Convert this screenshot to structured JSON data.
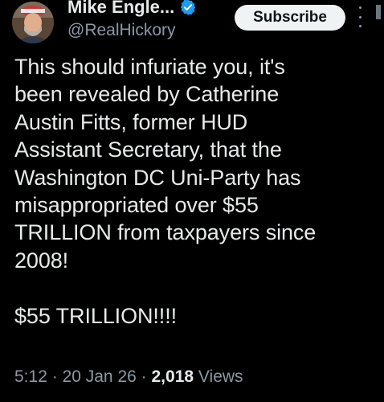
{
  "author": {
    "display_name": "Mike Engle...",
    "handle": "@RealHickory",
    "verified_icon": "verified-badge-icon",
    "avatar": "profile-photo"
  },
  "actions": {
    "subscribe_label": "Subscribe",
    "more_icon": "more-options-icon"
  },
  "tweet": {
    "text": "This should infuriate you, it's\nbeen revealed by Catherine\nAustin Fitts, former HUD\nAssistant Secretary, that the\nWashington DC Uni-Party has\nmisappropriated over $55\nTRILLION from taxpayers since\n2008!\n\n$55 TRILLION!!!!",
    "time": "5:12",
    "separator": "·",
    "date": "20 Jan 26",
    "views_count": "2,018",
    "views_label": "Views"
  },
  "colors": {
    "background": "#000000",
    "text": "#e7e9ea",
    "secondary_text": "#8b98a5",
    "verified": "#1d9bf0",
    "button_bg": "#eff3f4"
  }
}
